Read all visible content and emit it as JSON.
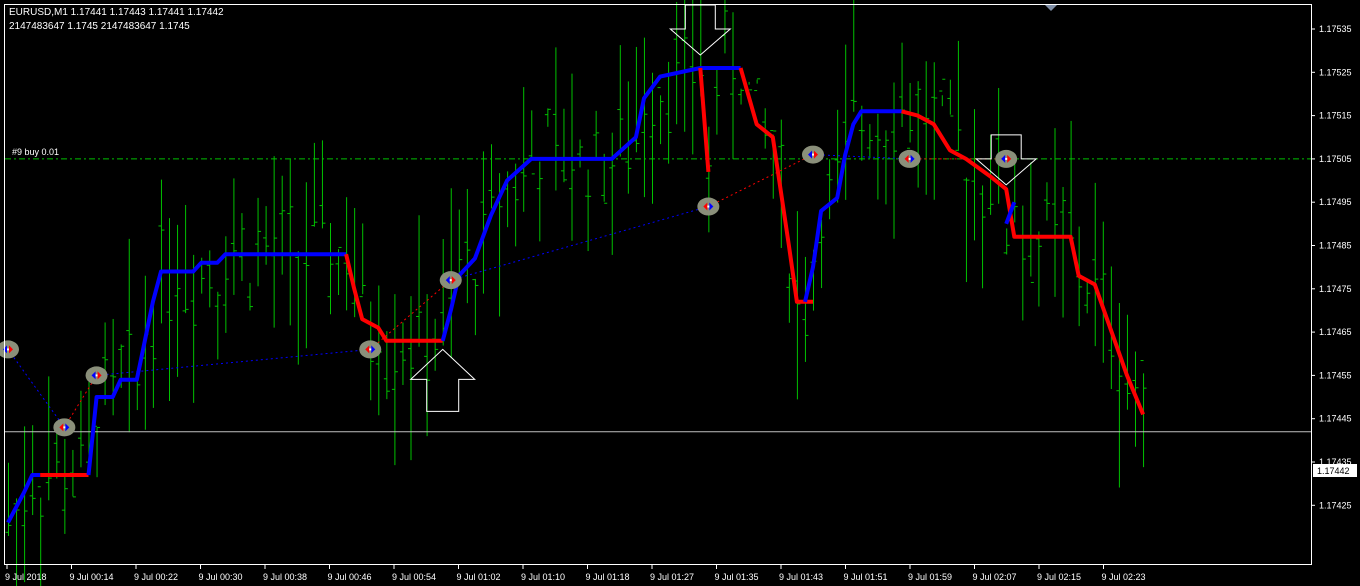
{
  "header": {
    "symbol_line": "EURUSD,M1  1.17441 1.17443 1.17441 1.17442",
    "indicator_line": "2147483647  1.1745  2147483647  1.1745"
  },
  "order_line": {
    "label": "#9 buy 0.01",
    "price": 1.17505,
    "color": "#00c000"
  },
  "current_price": {
    "value": 1.17442,
    "label": "1.17442"
  },
  "colors": {
    "background": "#000000",
    "candles": "#00c000",
    "trend_up": "#0000ff",
    "trend_down": "#ff0000",
    "grid_axis": "#ffffff",
    "arrow_outline": "#ffffff"
  },
  "chart_data": {
    "type": "line",
    "y_axis": {
      "range": [
        1.17418,
        1.17545
      ],
      "ticks": [
        "1.17535",
        "1.17525",
        "1.17515",
        "1.17505",
        "1.17495",
        "1.17485",
        "1.17475",
        "1.17465",
        "1.17455",
        "1.17445",
        "1.17435",
        "1.17425"
      ]
    },
    "x_axis": {
      "ticks": [
        "9 Jul 2018",
        "9 Jul 00:14",
        "9 Jul 00:22",
        "9 Jul 00:30",
        "9 Jul 00:38",
        "9 Jul 00:46",
        "9 Jul 00:54",
        "9 Jul 01:02",
        "9 Jul 01:10",
        "9 Jul 01:18",
        "9 Jul 01:27",
        "9 Jul 01:35",
        "9 Jul 01:43",
        "9 Jul 01:51",
        "9 Jul 01:59",
        "9 Jul 02:07",
        "9 Jul 02:15",
        "9 Jul 02:23"
      ]
    },
    "trend_segments": [
      {
        "color": "up",
        "points": [
          [
            0,
            1.17421
          ],
          [
            2,
            1.17428
          ],
          [
            3,
            1.17432
          ],
          [
            4,
            1.17432
          ]
        ]
      },
      {
        "color": "down",
        "points": [
          [
            4,
            1.17432
          ],
          [
            10,
            1.17432
          ]
        ]
      },
      {
        "color": "up",
        "points": [
          [
            10,
            1.17432
          ],
          [
            11,
            1.1745
          ],
          [
            13,
            1.1745
          ],
          [
            14,
            1.17454
          ],
          [
            16,
            1.17454
          ],
          [
            18,
            1.17472
          ],
          [
            19,
            1.17479
          ],
          [
            23,
            1.17479
          ],
          [
            24,
            1.17481
          ],
          [
            26,
            1.17481
          ],
          [
            27,
            1.17483
          ],
          [
            42,
            1.17483
          ]
        ]
      },
      {
        "color": "down",
        "points": [
          [
            42,
            1.17483
          ],
          [
            43,
            1.17475
          ],
          [
            44,
            1.17468
          ],
          [
            46,
            1.17466
          ],
          [
            47,
            1.17463
          ],
          [
            54,
            1.17463
          ]
        ]
      },
      {
        "color": "up",
        "points": [
          [
            54,
            1.17463
          ],
          [
            55,
            1.1747
          ],
          [
            56,
            1.17478
          ],
          [
            58,
            1.17482
          ],
          [
            60,
            1.17492
          ],
          [
            62,
            1.175
          ],
          [
            65,
            1.17505
          ],
          [
            75,
            1.17505
          ],
          [
            78,
            1.1751
          ],
          [
            79,
            1.17519
          ],
          [
            81,
            1.17524
          ],
          [
            86,
            1.17526
          ],
          [
            91,
            1.17526
          ]
        ]
      },
      {
        "color": "down",
        "points": [
          [
            86,
            1.17526
          ],
          [
            87,
            1.17502
          ]
        ]
      },
      {
        "color": "down",
        "points": [
          [
            91,
            1.17526
          ],
          [
            93,
            1.17513
          ],
          [
            95,
            1.1751
          ],
          [
            97,
            1.17485
          ],
          [
            98,
            1.17472
          ],
          [
            100,
            1.17472
          ]
        ]
      },
      {
        "color": "up",
        "points": [
          [
            99,
            1.17472
          ],
          [
            100,
            1.1748
          ],
          [
            101,
            1.17493
          ],
          [
            103,
            1.17496
          ],
          [
            104,
            1.17506
          ],
          [
            105,
            1.17513
          ],
          [
            106,
            1.17516
          ],
          [
            111,
            1.17516
          ]
        ]
      },
      {
        "color": "down",
        "points": [
          [
            111,
            1.17516
          ],
          [
            113,
            1.17515
          ],
          [
            115,
            1.17513
          ],
          [
            117,
            1.17507
          ],
          [
            119,
            1.17505
          ],
          [
            122,
            1.17501
          ],
          [
            124,
            1.17498
          ],
          [
            125,
            1.17487
          ],
          [
            132,
            1.17487
          ],
          [
            133,
            1.17478
          ],
          [
            135,
            1.17476
          ],
          [
            139,
            1.17455
          ],
          [
            141,
            1.17446
          ]
        ]
      },
      {
        "color": "up",
        "points": [
          [
            124,
            1.1749
          ],
          [
            125,
            1.17495
          ]
        ]
      }
    ],
    "signals": [
      {
        "i": 0,
        "price": 1.17461,
        "type": "buy"
      },
      {
        "i": 7,
        "price": 1.17443,
        "type": "sell"
      },
      {
        "i": 11,
        "price": 1.17455,
        "type": "buy"
      },
      {
        "i": 45,
        "price": 1.17461,
        "type": "sell"
      },
      {
        "i": 55,
        "price": 1.17477,
        "type": "buy"
      },
      {
        "i": 87,
        "price": 1.17494,
        "type": "sell"
      },
      {
        "i": 100,
        "price": 1.17506,
        "type": "buy"
      },
      {
        "i": 112,
        "price": 1.17505,
        "type": "sell"
      },
      {
        "i": 124,
        "price": 1.17505,
        "type": "buy"
      }
    ],
    "big_arrows": [
      {
        "direction": "up",
        "i": 54,
        "price": 1.17461
      },
      {
        "direction": "down",
        "i": 86,
        "price": 1.17529
      },
      {
        "direction": "down",
        "i": 124,
        "price": 1.17499
      }
    ]
  }
}
